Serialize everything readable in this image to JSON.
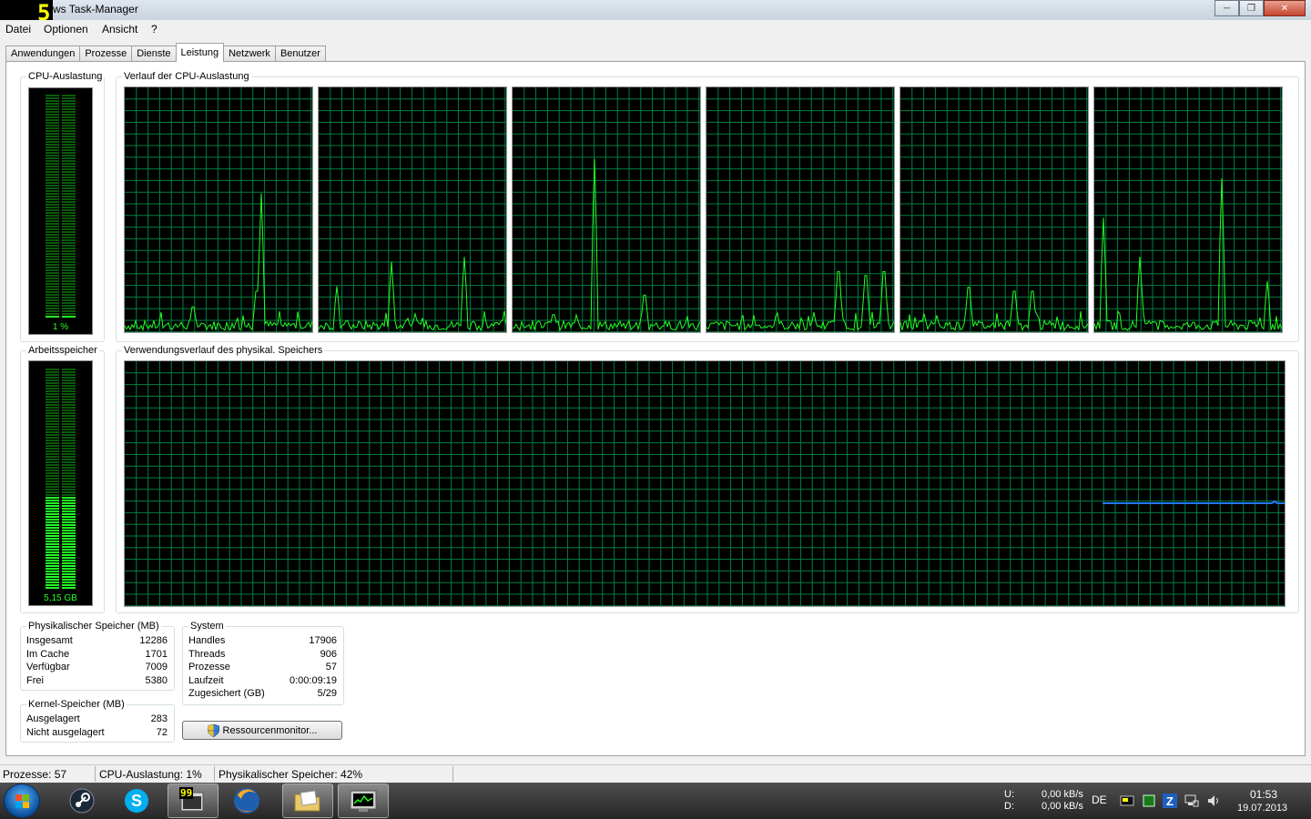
{
  "window": {
    "title_prefix": "5",
    "title": "ws Task-Manager",
    "controls": {
      "minimize": "─",
      "maximize": "❐",
      "close": "✕"
    }
  },
  "menu": [
    "Datei",
    "Optionen",
    "Ansicht",
    "?"
  ],
  "tabs": [
    "Anwendungen",
    "Prozesse",
    "Dienste",
    "Leistung",
    "Netzwerk",
    "Benutzer"
  ],
  "active_tab": "Leistung",
  "performance": {
    "cpu_group_label": "CPU-Auslastung",
    "cpu_meter_value": "1 %",
    "cpu_history_label": "Verlauf der CPU-Auslastung",
    "mem_group_label": "Arbeitsspeicher",
    "mem_meter_value": "5,15 GB",
    "mem_history_label": "Verwendungsverlauf des physikal. Speichers"
  },
  "physical_memory": {
    "label": "Physikalischer Speicher (MB)",
    "rows": [
      {
        "name": "Insgesamt",
        "value": "12286"
      },
      {
        "name": "Im Cache",
        "value": "1701"
      },
      {
        "name": "Verfügbar",
        "value": "7009"
      },
      {
        "name": "Frei",
        "value": "5380"
      }
    ]
  },
  "kernel_memory": {
    "label": "Kernel-Speicher (MB)",
    "rows": [
      {
        "name": "Ausgelagert",
        "value": "283"
      },
      {
        "name": "Nicht ausgelagert",
        "value": "72"
      }
    ]
  },
  "system": {
    "label": "System",
    "rows": [
      {
        "name": "Handles",
        "value": "17906"
      },
      {
        "name": "Threads",
        "value": "906"
      },
      {
        "name": "Prozesse",
        "value": "57"
      },
      {
        "name": "Laufzeit",
        "value": "0:00:09:19"
      },
      {
        "name": "Zugesichert (GB)",
        "value": "5/29"
      }
    ]
  },
  "resource_monitor_button": "Ressourcenmonitor...",
  "statusbar": {
    "processes": "Prozesse: 57",
    "cpu": "CPU-Auslastung: 1%",
    "memory": "Physikalischer Speicher: 42%"
  },
  "taskbar": {
    "badge": "99",
    "net_up_label": "U:",
    "net_down_label": "D:",
    "net_up": "0,00 kB/s",
    "net_down": "0,00 kB/s",
    "language": "DE",
    "time": "01:53",
    "date": "19.07.2013"
  },
  "colors": {
    "graph_bg": "#000000",
    "grid": "#008040",
    "cpu_line": "#22ff22",
    "mem_line": "#2277ff"
  },
  "levels": {
    "cpu_fraction": 0.01,
    "memory_fraction": 0.42
  }
}
